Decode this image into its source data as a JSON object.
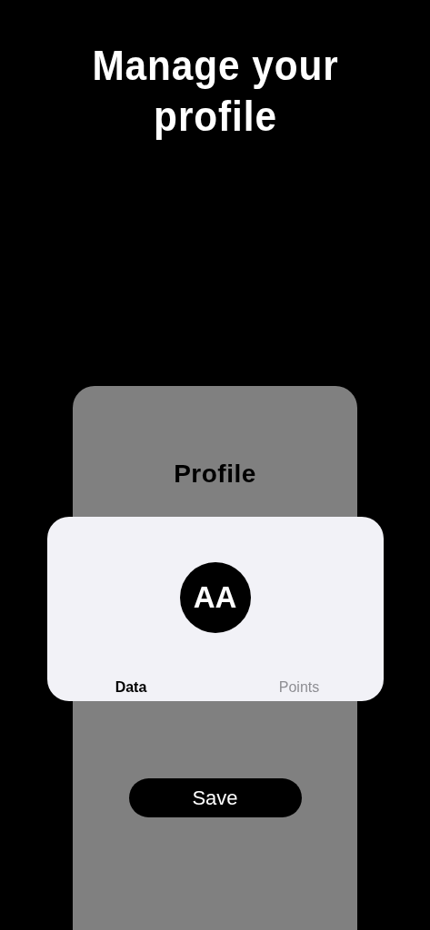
{
  "headline": "Manage your profile",
  "phone": {
    "title": "Profile",
    "avatar": {
      "initials": "AA"
    },
    "tabs": [
      {
        "label": "Data",
        "selected": true
      },
      {
        "label": "Points",
        "selected": false
      }
    ],
    "button": "Save"
  }
}
